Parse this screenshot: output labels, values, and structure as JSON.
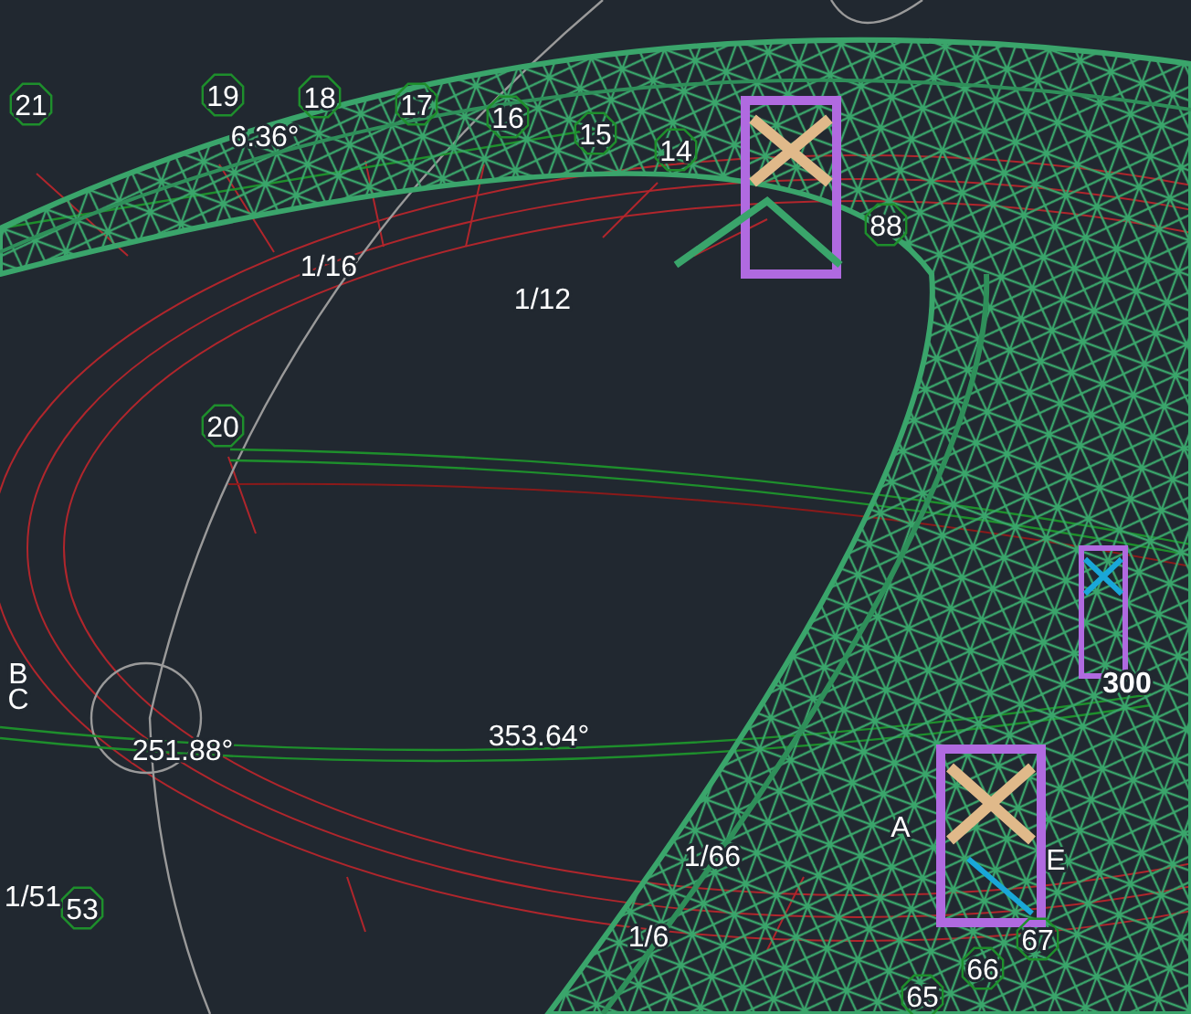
{
  "grid_bubbles": [
    {
      "label": "21"
    },
    {
      "label": "19"
    },
    {
      "label": "18"
    },
    {
      "label": "17"
    },
    {
      "label": "16"
    },
    {
      "label": "15"
    },
    {
      "label": "14"
    },
    {
      "label": "88"
    },
    {
      "label": "20"
    },
    {
      "label": "53"
    },
    {
      "label": "67"
    },
    {
      "label": "66"
    },
    {
      "label": "65"
    }
  ],
  "labels": [
    {
      "text": "6.36°"
    },
    {
      "text": "1/16"
    },
    {
      "text": "1/12"
    },
    {
      "text": "251.88°"
    },
    {
      "text": "353.64°"
    },
    {
      "text": "300"
    },
    {
      "text": "1/66"
    },
    {
      "text": "1/6"
    },
    {
      "text": "1/51"
    },
    {
      "text": "A"
    },
    {
      "text": "E"
    },
    {
      "text": "B"
    },
    {
      "text": "C"
    }
  ]
}
